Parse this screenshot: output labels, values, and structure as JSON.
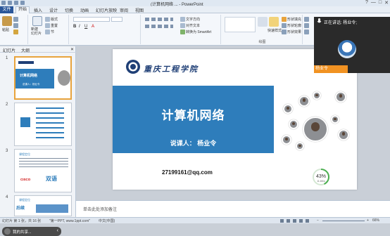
{
  "window": {
    "title": "(计算机网络 ... - PowerPoint",
    "controls": [
      "?",
      "—",
      "□",
      "✕"
    ]
  },
  "tabs": [
    "文件",
    "开始",
    "插入",
    "设计",
    "切换",
    "动画",
    "幻灯片放映",
    "审阅",
    "视图"
  ],
  "ribbon": {
    "clipboard": {
      "paste": "粘贴",
      "cut": "剪切",
      "copy": "复制",
      "format": "格式刷"
    },
    "slides": {
      "new_slide": "新建\n幻灯片",
      "layout": "版式",
      "reset": "重置",
      "section": "节"
    },
    "paragraph": {
      "text_direction": "文字方向",
      "align_text": "对齐文本",
      "smartart": "转换为 SmartArt"
    },
    "drawing": {
      "label": "绘图",
      "fill": "形状填充",
      "outline": "形状轮廓",
      "effect": "形状效果",
      "quick_styles": "快速样式"
    },
    "editing": {
      "find": "查找",
      "replace": "替换",
      "select": "选择"
    },
    "voice": {
      "label": "听写"
    }
  },
  "left_panel": {
    "tab_slides": "幻灯片",
    "tab_outline": "大纲",
    "slide_numbers": [
      "1",
      "2",
      "3",
      "4"
    ]
  },
  "thumbnails": {
    "t1_title": "计算机网络",
    "t1_lecturer": "说课人：杨业令",
    "t3_label": "课程定位",
    "t3_cisco": "CISCO",
    "t3_dual": "双语",
    "t4_label": "课程定位",
    "t4_text": "后续"
  },
  "slide": {
    "school": "重庆工程学院",
    "title": "计算机网络",
    "lecturer": "说课人：  杨业令",
    "email": "27199161@qq.com",
    "gauge_percent": "43%",
    "gauge_value": 43,
    "gauge_sub": "11.6K/s"
  },
  "notes": {
    "placeholder": "单击此处添加备注"
  },
  "status": {
    "slide_info": "幻灯片 第 1 张，共 16 张",
    "theme": "\"第一PPT, www.1ppt.com\"",
    "lang": "中文(中国)",
    "zoom": "66%"
  },
  "video": {
    "live_label": "正在讲话: 杨业令;",
    "name": "杨业令"
  },
  "float_bar": {
    "label": "我的共享..."
  },
  "colors": {
    "accent": "#2e7dbb",
    "file_tab": "#2b579a",
    "name_tag": "#f19222"
  }
}
